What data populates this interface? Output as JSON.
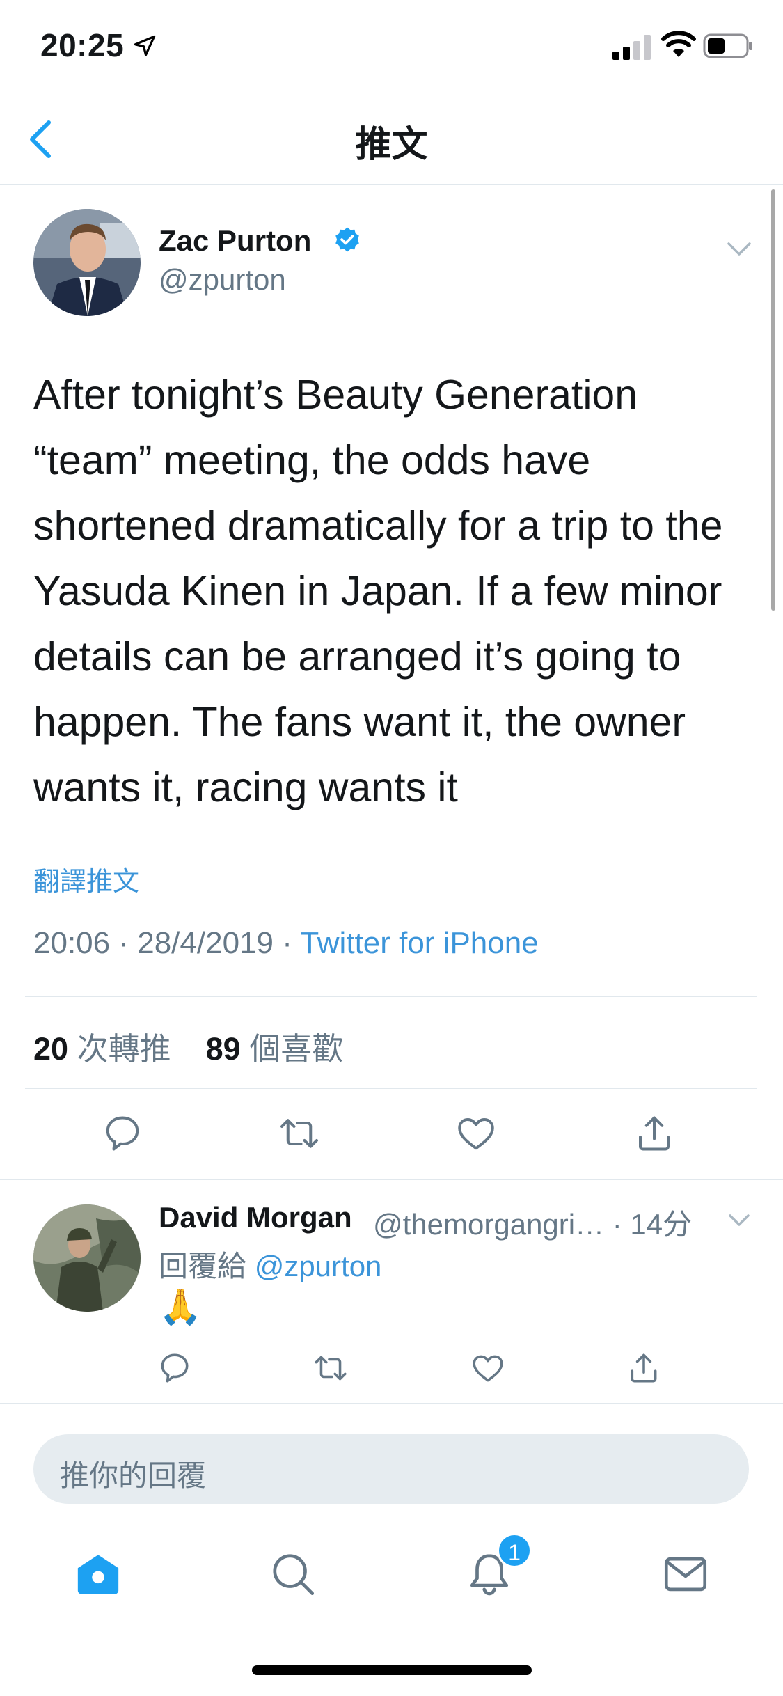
{
  "status_bar": {
    "time": "20:25",
    "icons": [
      "location-arrow-icon",
      "signal-icon",
      "wifi-icon",
      "battery-icon"
    ]
  },
  "nav": {
    "title": "推文",
    "back_icon": "chevron-left-icon"
  },
  "tweet": {
    "author_name": "Zac Purton",
    "handle": "@zpurton",
    "verified": true,
    "text": "After tonight’s Beauty Generation “team” meeting, the odds have shortened dramatically for a trip to the Yasuda Kinen in Japan. If a few minor details can be arranged it’s going to happen. The fans want it, the owner wants it, racing wants it",
    "translate_label": "翻譯推文",
    "time": "20:06",
    "date": "28/4/2019",
    "source": "Twitter for iPhone",
    "retweet_count": "20",
    "retweet_label": "次轉推",
    "like_count": "89",
    "like_label": "個喜歡"
  },
  "reply": {
    "author_name": "David Morgan",
    "handle": "@themorgangri…",
    "age": "· 14分",
    "reply_prefix": "回覆給",
    "mention": "@zpurton",
    "text": "🙏"
  },
  "composer": {
    "placeholder": "推你的回覆"
  },
  "tab_bar": {
    "notification_badge": "1",
    "tabs": [
      "home-icon",
      "search-icon",
      "bell-icon",
      "mail-icon"
    ]
  },
  "colors": {
    "accent": "#1da1f2",
    "link": "#3b94d9",
    "muted": "#657786",
    "divider": "#e1e8ed"
  }
}
